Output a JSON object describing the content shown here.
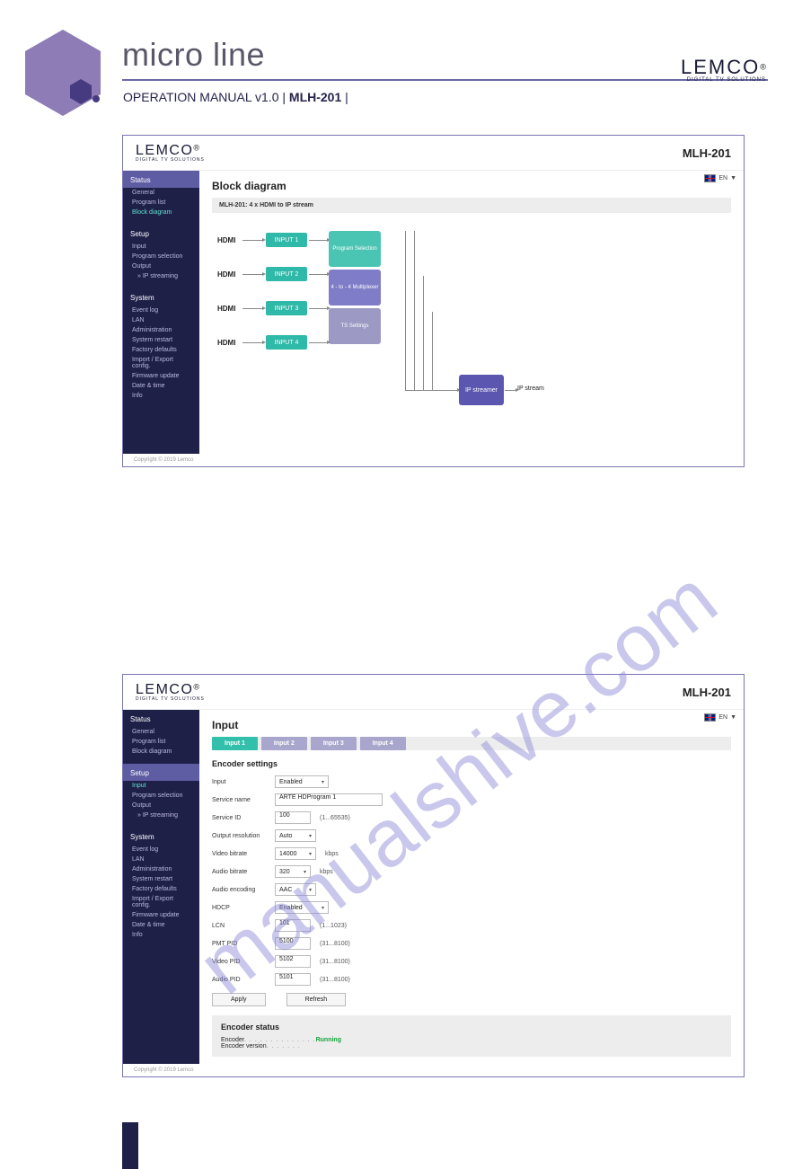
{
  "page_header": {
    "product_line": "micro line",
    "subtitle_prefix": "OPERATION MANUAL v1.0 | ",
    "subtitle_model": "MLH-201",
    "subtitle_suffix": " |",
    "brand": "LEMCO",
    "brand_tag": "DIGITAL TV SOLUTIONS"
  },
  "watermark": "manualshive.com",
  "shot1": {
    "brand": "LEMCO",
    "brand_tag": "DIGITAL TV SOLUTIONS",
    "model": "MLH-201",
    "lang": "EN",
    "title": "Block diagram",
    "subhead": "MLH-201:   4 x HDMI to IP stream",
    "sidebar": {
      "status": {
        "head": "Status",
        "items": [
          "General",
          "Program list",
          "Block diagram"
        ],
        "current": 2
      },
      "setup": {
        "head": "Setup",
        "items": [
          "Input",
          "Program selection",
          "Output",
          "  » IP streaming"
        ]
      },
      "system": {
        "head": "System",
        "items": [
          "Event log",
          "LAN",
          "Administration",
          "System restart",
          "Factory defaults",
          "Import / Export config.",
          "Firmware update",
          "Date & time",
          "Info"
        ]
      }
    },
    "diagram": {
      "hdmi": "HDMI",
      "inputs": [
        "INPUT 1",
        "INPUT 2",
        "INPUT 3",
        "INPUT 4"
      ],
      "program_selection": "Program Selection",
      "multiplexer": "4 - to - 4 Multiplexer",
      "ts_settings": "TS Settings",
      "ip_streamer": "IP streamer",
      "ip_stream": "IP stream"
    },
    "copyright": "Copyright © 2019 Lemco"
  },
  "shot2": {
    "brand": "LEMCO",
    "brand_tag": "DIGITAL TV SOLUTIONS",
    "model": "MLH-201",
    "lang": "EN",
    "title": "Input",
    "tabs": [
      "Input 1",
      "Input 2",
      "Input 3",
      "Input 4"
    ],
    "active_tab": 0,
    "sidebar": {
      "status": {
        "head": "Status",
        "items": [
          "General",
          "Program list",
          "Block diagram"
        ]
      },
      "setup": {
        "head": "Setup",
        "items": [
          "Input",
          "Program selection",
          "Output",
          "  » IP streaming"
        ],
        "current": 0,
        "active": true
      },
      "system": {
        "head": "System",
        "items": [
          "Event log",
          "LAN",
          "Administration",
          "System restart",
          "Factory defaults",
          "Import / Export config.",
          "Firmware update",
          "Date & time",
          "Info"
        ]
      }
    },
    "encoder_settings_title": "Encoder settings",
    "form": {
      "input": {
        "label": "Input",
        "value": "Enabled"
      },
      "service_name": {
        "label": "Service name",
        "value": "ARTE HDProgram 1"
      },
      "service_id": {
        "label": "Service ID",
        "value": "100",
        "hint": "(1...65535)"
      },
      "output_resolution": {
        "label": "Output resolution",
        "value": "Auto"
      },
      "video_bitrate": {
        "label": "Video bitrate",
        "value": "14000",
        "unit": "kbps"
      },
      "audio_bitrate": {
        "label": "Audio bitrate",
        "value": "320",
        "unit": "kbps"
      },
      "audio_encoding": {
        "label": "Audio encoding",
        "value": "AAC"
      },
      "hdcp": {
        "label": "HDCP",
        "value": "Enabled"
      },
      "lcn": {
        "label": "LCN",
        "value": "101",
        "hint": "(1...1023)"
      },
      "pmt_pid": {
        "label": "PMT PID",
        "value": "5100",
        "hint": "(31...8100)"
      },
      "video_pid": {
        "label": "Video PID",
        "value": "5102",
        "hint": "(31...8100)"
      },
      "audio_pid": {
        "label": "Audio PID",
        "value": "5101",
        "hint": "(31...8100)"
      }
    },
    "apply_btn": "Apply",
    "refresh_btn": "Refresh",
    "encoder_status_title": "Encoder status",
    "encoder_label": "Encoder",
    "encoder_state": "Running",
    "encoder_version_label": "Encoder version",
    "copyright": "Copyright © 2019 Lemco"
  }
}
